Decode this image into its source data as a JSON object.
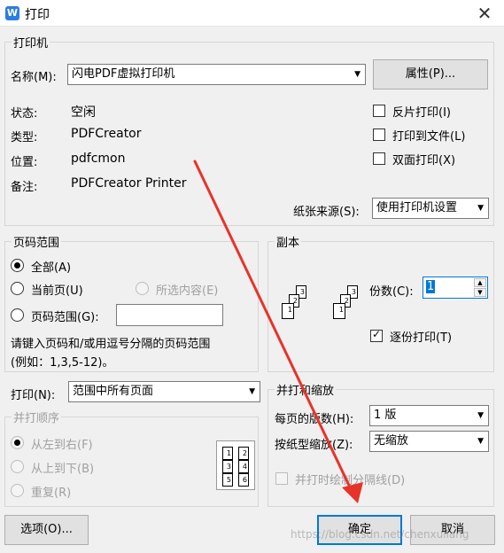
{
  "window": {
    "title": "打印",
    "app_icon": "W",
    "close": "✕"
  },
  "printer": {
    "group_title": "打印机",
    "name_label": "名称(M):",
    "name_value": "闪电PDF虚拟打印机",
    "properties_button": "属性(P)...",
    "status_label": "状态:",
    "status_value": "空闲",
    "type_label": "类型:",
    "type_value": "PDFCreator",
    "location_label": "位置:",
    "location_value": "pdfcmon",
    "comment_label": "备注:",
    "comment_value": "PDFCreator Printer",
    "reverse_print": "反片打印(I)",
    "print_to_file": "打印到文件(L)",
    "duplex": "双面打印(X)",
    "paper_source_label": "纸张来源(S):",
    "paper_source_value": "使用打印机设置"
  },
  "page_range": {
    "group_title": "页码范围",
    "all": "全部(A)",
    "current": "当前页(U)",
    "selection": "所选内容(E)",
    "pages": "页码范围(G):",
    "pages_value": "",
    "hint_line1": "请键入页码和/或用逗号分隔的页码范围",
    "hint_line2": "(例如：1,3,5-12)。"
  },
  "copies": {
    "group_title": "副本",
    "count_label": "份数(C):",
    "count_value": "1",
    "collate": "逐份打印(T)",
    "icon_pages": [
      "1",
      "2",
      "3"
    ]
  },
  "print_what": {
    "label": "打印(N):",
    "value": "范围中所有页面"
  },
  "order": {
    "group_title": "并打顺序",
    "left_to_right": "从左到右(F)",
    "top_to_bottom": "从上到下(B)",
    "repeat": "重复(R)",
    "preview_pages": [
      "1",
      "2",
      "3",
      "4",
      "5",
      "6"
    ]
  },
  "zoom": {
    "group_title": "并打和缩放",
    "pages_per_sheet_label": "每页的版数(H):",
    "pages_per_sheet_value": "1 版",
    "scale_label": "按纸型缩放(Z):",
    "scale_value": "无缩放",
    "draw_borders": "并打时绘制分隔线(D)"
  },
  "buttons": {
    "options": "选项(O)...",
    "ok": "确定",
    "cancel": "取消"
  },
  "watermark": "https://blog.csdn.net/chenxuliang",
  "colors": {
    "accent": "#0078d7",
    "arrow": "#e8332a",
    "app_icon": "#2a7de1"
  }
}
